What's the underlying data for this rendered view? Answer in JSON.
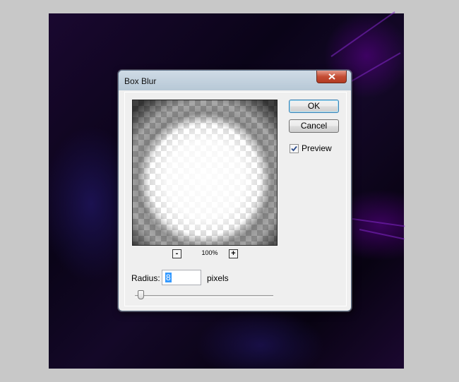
{
  "dialog": {
    "title": "Box Blur",
    "ok_label": "OK",
    "cancel_label": "Cancel",
    "preview_label": "Preview",
    "preview_checked": true,
    "zoom_out_label": "-",
    "zoom_in_label": "+",
    "zoom_level": "100%",
    "radius_label": "Radius:",
    "radius_value": "8",
    "units_label": "pixels"
  },
  "icons": {
    "close": "close-icon",
    "check": "checkmark-icon"
  },
  "colors": {
    "close_button": "#c44d34",
    "selection": "#3399ff",
    "canvas_dark": "#0a0418"
  }
}
